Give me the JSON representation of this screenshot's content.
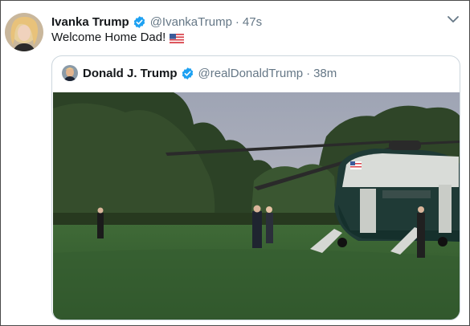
{
  "tweet": {
    "author_name": "Ivanka Trump",
    "author_handle": "@IvankaTrump",
    "separator": "·",
    "time": "47s",
    "text": "Welcome Home Dad!",
    "icons": {
      "verified": "verified-badge-icon",
      "more": "chevron-down-icon",
      "flag": "us-flag-emoji"
    }
  },
  "quoted": {
    "author_name": "Donald J. Trump",
    "author_handle": "@realDonaldTrump",
    "separator": "·",
    "time": "38m",
    "media": "video-thumbnail"
  },
  "colors": {
    "accent": "#1da1f2",
    "secondary_text": "#657786",
    "primary_text": "#14171a",
    "border": "#ccd6dd"
  }
}
